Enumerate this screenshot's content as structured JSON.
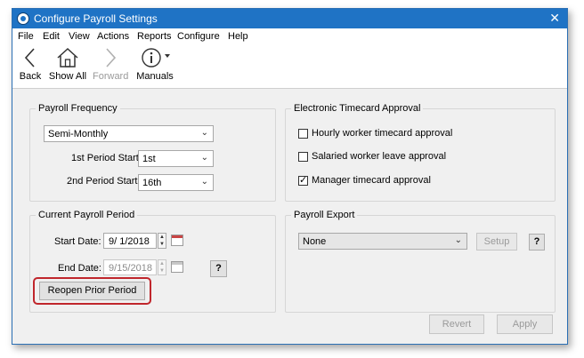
{
  "window": {
    "title": "Configure Payroll Settings",
    "close": "✕"
  },
  "menu": [
    "File",
    "Edit",
    "View",
    "Actions",
    "Reports",
    "Configure",
    "Help"
  ],
  "toolbar": {
    "back": "Back",
    "show_all": "Show All",
    "forward": "Forward",
    "manuals": "Manuals"
  },
  "payroll_frequency": {
    "title": "Payroll Frequency",
    "frequency_value": "Semi-Monthly",
    "first_label": "1st Period Start:",
    "first_value": "1st",
    "second_label": "2nd Period Start:",
    "second_value": "16th"
  },
  "timecard": {
    "title": "Electronic Timecard Approval",
    "items": [
      {
        "label": "Hourly worker timecard approval",
        "checked": false
      },
      {
        "label": "Salaried worker leave approval",
        "checked": false
      },
      {
        "label": "Manager timecard approval",
        "checked": true
      }
    ]
  },
  "current_period": {
    "title": "Current Payroll Period",
    "start_label": "Start Date:",
    "start_value": "9/  1/2018",
    "end_label": "End Date:",
    "end_value": "9/15/2018",
    "help": "?",
    "reopen": "Reopen Prior Period"
  },
  "export": {
    "title": "Payroll Export",
    "value": "None",
    "setup": "Setup",
    "help": "?"
  },
  "footer": {
    "revert": "Revert",
    "apply": "Apply"
  },
  "colors": {
    "titlebar": "#1f73c5",
    "highlight": "#c0262c"
  }
}
